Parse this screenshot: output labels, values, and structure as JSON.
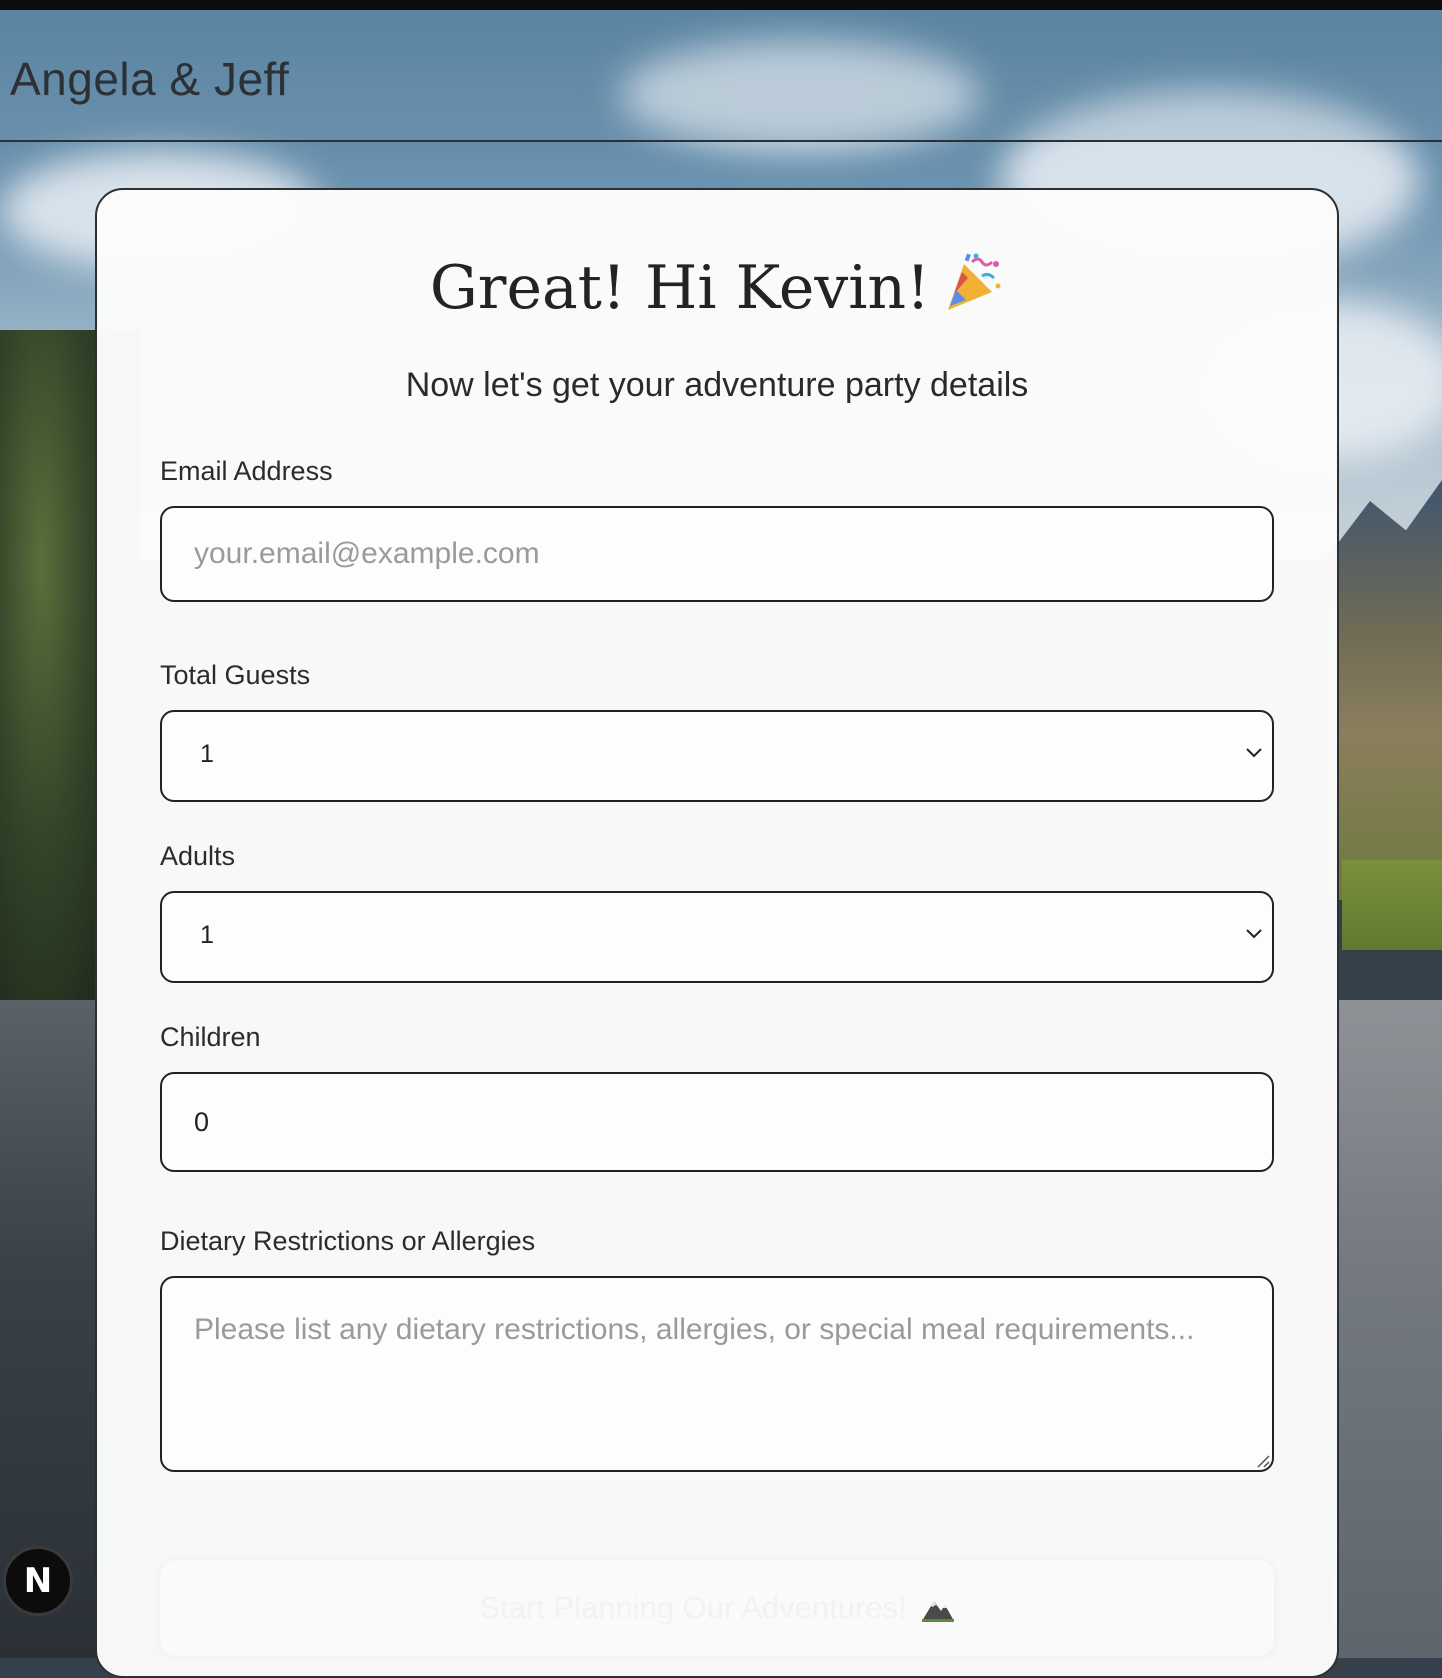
{
  "header": {
    "brand": "Angela & Jeff"
  },
  "card": {
    "title": "Great! Hi Kevin!",
    "title_emoji": "party-popper-icon",
    "subtitle": "Now let's get your adventure party details"
  },
  "form": {
    "email": {
      "label": "Email Address",
      "value": "",
      "placeholder": "your.email@example.com"
    },
    "total_guests": {
      "label": "Total Guests",
      "value": "1"
    },
    "adults": {
      "label": "Adults",
      "value": "1"
    },
    "children": {
      "label": "Children",
      "value": "0"
    },
    "dietary": {
      "label": "Dietary Restrictions or Allergies",
      "value": "",
      "placeholder": "Please list any dietary restrictions, allergies, or special meal requirements..."
    },
    "submit_label": "Start Planning Our Adventures!",
    "submit_icon": "mountain-icon"
  },
  "badge": {
    "label": "N"
  }
}
